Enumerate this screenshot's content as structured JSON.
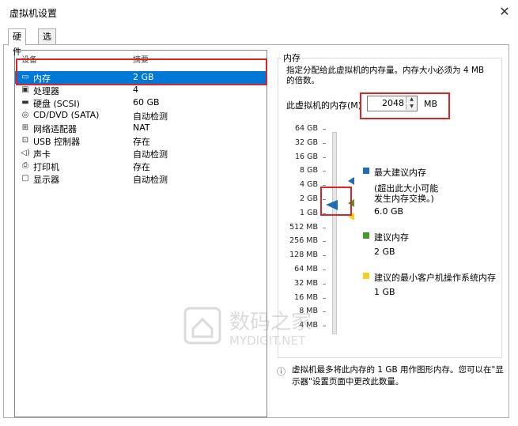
{
  "window": {
    "title": "虚拟机设置",
    "close_glyph": "✕"
  },
  "tabs": [
    {
      "label": "硬件"
    },
    {
      "label": "选项"
    }
  ],
  "device_list": {
    "headers": {
      "device": "设备",
      "summary": "摘要"
    },
    "items": [
      {
        "icon": "memory-icon",
        "name": "内存",
        "summary": "2 GB",
        "selected": true
      },
      {
        "icon": "cpu-icon",
        "name": "处理器",
        "summary": "4",
        "selected": false
      },
      {
        "icon": "disk-icon",
        "name": "硬盘 (SCSI)",
        "summary": "60 GB",
        "selected": false
      },
      {
        "icon": "cd-icon",
        "name": "CD/DVD (SATA)",
        "summary": "自动检测",
        "selected": false
      },
      {
        "icon": "network-icon",
        "name": "网络适配器",
        "summary": "NAT",
        "selected": false
      },
      {
        "icon": "usb-icon",
        "name": "USB 控制器",
        "summary": "存在",
        "selected": false
      },
      {
        "icon": "sound-icon",
        "name": "声卡",
        "summary": "自动检测",
        "selected": false
      },
      {
        "icon": "printer-icon",
        "name": "打印机",
        "summary": "存在",
        "selected": false
      },
      {
        "icon": "display-icon",
        "name": "显示器",
        "summary": "自动检测",
        "selected": false
      }
    ]
  },
  "memory": {
    "group_title": "内存",
    "description": "指定分配给此虚拟机的内存量。内存大小必须为 4 MB 的倍数。",
    "field_label": "此虚拟机的内存(M)",
    "value": "2048",
    "unit": "MB",
    "scale": [
      "64 GB",
      "32 GB",
      "16 GB",
      "8 GB",
      "4 GB",
      "2 GB",
      "1 GB",
      "512 MB",
      "256 MB",
      "128 MB",
      "64 MB",
      "32 MB",
      "16 MB",
      "8 MB",
      "4 MB"
    ],
    "legend": {
      "max_title": "最大建议内存",
      "max_note_1": "(超出此大小可能",
      "max_note_2": "发生内存交换。)",
      "max_value": "6.0 GB",
      "rec_title": "建议内存",
      "rec_value": "2 GB",
      "min_title": "建议的最小客户机操作系统内存",
      "min_value": "1 GB"
    },
    "note": "虚拟机最多将此内存的 1 GB 用作图形内存。您可以在\"显示器\"设置页面中更改此数量。"
  },
  "watermark": {
    "cn": "数码之家",
    "en": "MYDIGIT.NET"
  },
  "colors": {
    "selection": "#0078d7",
    "highlight": "#d9252a",
    "max": "#1f6db5",
    "recommended": "#4a9a2a",
    "minimum": "#f2d21b"
  }
}
